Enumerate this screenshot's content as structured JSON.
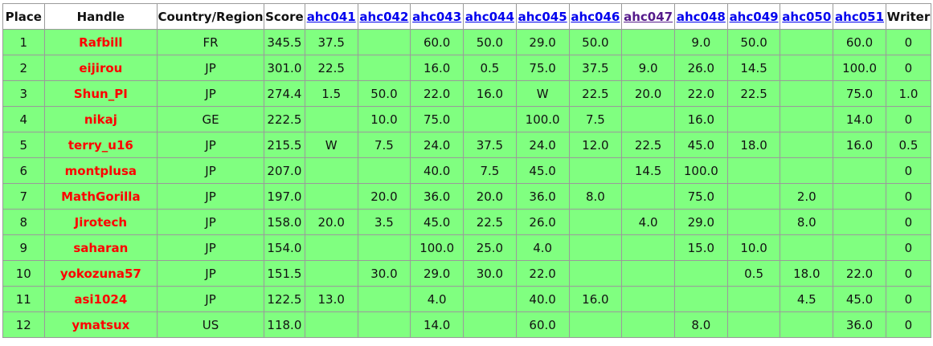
{
  "headers": {
    "place": "Place",
    "handle": "Handle",
    "country": "Country/Region",
    "score": "Score",
    "contests": [
      "ahc041",
      "ahc042",
      "ahc043",
      "ahc044",
      "ahc045",
      "ahc046",
      "ahc047",
      "ahc048",
      "ahc049",
      "ahc050",
      "ahc051"
    ],
    "writer": "Writer"
  },
  "visited_contest": "ahc047",
  "colors": {
    "row_bg": "#80ff80",
    "handle": "#ff0000",
    "link": "#0000ee",
    "visited_link": "#551a8b"
  },
  "rows": [
    {
      "place": "1",
      "handle": "Rafbill",
      "country": "FR",
      "score": "345.5",
      "contests": [
        "37.5",
        "",
        "60.0",
        "50.0",
        "29.0",
        "50.0",
        "",
        "9.0",
        "50.0",
        "",
        "60.0"
      ],
      "writer": "0"
    },
    {
      "place": "2",
      "handle": "eijirou",
      "country": "JP",
      "score": "301.0",
      "contests": [
        "22.5",
        "",
        "16.0",
        "0.5",
        "75.0",
        "37.5",
        "9.0",
        "26.0",
        "14.5",
        "",
        "100.0"
      ],
      "writer": "0"
    },
    {
      "place": "3",
      "handle": "Shun_PI",
      "country": "JP",
      "score": "274.4",
      "contests": [
        "1.5",
        "50.0",
        "22.0",
        "16.0",
        "W",
        "22.5",
        "20.0",
        "22.0",
        "22.5",
        "",
        "75.0"
      ],
      "writer": "1.0"
    },
    {
      "place": "4",
      "handle": "nikaj",
      "country": "GE",
      "score": "222.5",
      "contests": [
        "",
        "10.0",
        "75.0",
        "",
        "100.0",
        "7.5",
        "",
        "16.0",
        "",
        "",
        "14.0"
      ],
      "writer": "0"
    },
    {
      "place": "5",
      "handle": "terry_u16",
      "country": "JP",
      "score": "215.5",
      "contests": [
        "W",
        "7.5",
        "24.0",
        "37.5",
        "24.0",
        "12.0",
        "22.5",
        "45.0",
        "18.0",
        "",
        "16.0"
      ],
      "writer": "0.5"
    },
    {
      "place": "6",
      "handle": "montplusa",
      "country": "JP",
      "score": "207.0",
      "contests": [
        "",
        "",
        "40.0",
        "7.5",
        "45.0",
        "",
        "14.5",
        "100.0",
        "",
        "",
        ""
      ],
      "writer": "0"
    },
    {
      "place": "7",
      "handle": "MathGorilla",
      "country": "JP",
      "score": "197.0",
      "contests": [
        "",
        "20.0",
        "36.0",
        "20.0",
        "36.0",
        "8.0",
        "",
        "75.0",
        "",
        "2.0",
        ""
      ],
      "writer": "0"
    },
    {
      "place": "8",
      "handle": "Jirotech",
      "country": "JP",
      "score": "158.0",
      "contests": [
        "20.0",
        "3.5",
        "45.0",
        "22.5",
        "26.0",
        "",
        "4.0",
        "29.0",
        "",
        "8.0",
        ""
      ],
      "writer": "0"
    },
    {
      "place": "9",
      "handle": "saharan",
      "country": "JP",
      "score": "154.0",
      "contests": [
        "",
        "",
        "100.0",
        "25.0",
        "4.0",
        "",
        "",
        "15.0",
        "10.0",
        "",
        ""
      ],
      "writer": "0"
    },
    {
      "place": "10",
      "handle": "yokozuna57",
      "country": "JP",
      "score": "151.5",
      "contests": [
        "",
        "30.0",
        "29.0",
        "30.0",
        "22.0",
        "",
        "",
        "",
        "0.5",
        "18.0",
        "22.0"
      ],
      "writer": "0"
    },
    {
      "place": "11",
      "handle": "asi1024",
      "country": "JP",
      "score": "122.5",
      "contests": [
        "13.0",
        "",
        "4.0",
        "",
        "40.0",
        "16.0",
        "",
        "",
        "",
        "4.5",
        "45.0"
      ],
      "writer": "0"
    },
    {
      "place": "12",
      "handle": "ymatsux",
      "country": "US",
      "score": "118.0",
      "contests": [
        "",
        "",
        "14.0",
        "",
        "60.0",
        "",
        "",
        "8.0",
        "",
        "",
        "36.0"
      ],
      "writer": "0"
    }
  ]
}
